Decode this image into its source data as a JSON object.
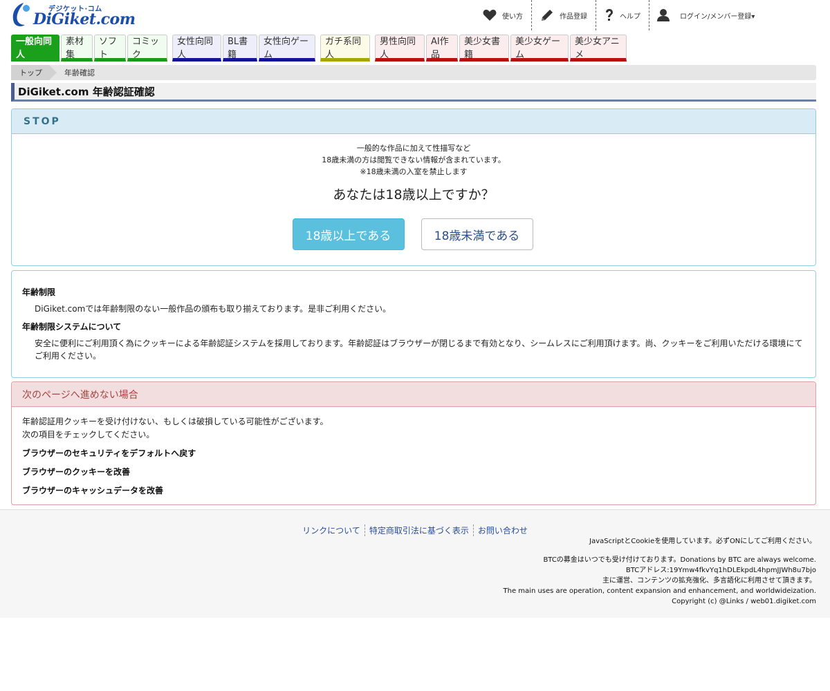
{
  "header": {
    "logo_sub": "デジケット·コム",
    "logo_main": "DiGiket.com",
    "nav": [
      {
        "icon": "heart-icon",
        "label": "使い方"
      },
      {
        "icon": "pencil-icon",
        "label": "作品登録"
      },
      {
        "icon": "question-icon",
        "label": "ヘルプ"
      },
      {
        "icon": "user-icon",
        "label": "ログイン/メンバー登録▾"
      }
    ]
  },
  "tabs": [
    {
      "label": "一般向同人",
      "group": "green",
      "active": true
    },
    {
      "label": "素材集",
      "group": "green"
    },
    {
      "label": "ソフト",
      "group": "green"
    },
    {
      "label": "コミック",
      "group": "green"
    },
    {
      "label": "女性向同人",
      "group": "blue"
    },
    {
      "label": "BL書籍",
      "group": "blue"
    },
    {
      "label": "女性向ゲーム",
      "group": "blue"
    },
    {
      "label": "ガチ系同人",
      "group": "yellow"
    },
    {
      "label": "男性向同人",
      "group": "red"
    },
    {
      "label": "AI作品",
      "group": "red"
    },
    {
      "label": "美少女書籍",
      "group": "red"
    },
    {
      "label": "美少女ゲーム",
      "group": "red"
    },
    {
      "label": "美少女アニメ",
      "group": "red"
    }
  ],
  "breadcrumb": {
    "top": "トップ",
    "current": "年齢確認"
  },
  "page_title": "DiGiket.com 年齢認証確認",
  "stop": {
    "heading": "STOP",
    "lines": [
      "一般的な作品に加えて性描写など",
      "18歳未満の方は閲覧できない情報が含まれています。",
      "※18歳未満の入室を禁止します"
    ],
    "question": "あなたは18歳以上ですか？",
    "yes_label": "18歳以上である",
    "no_label": "18歳未満である"
  },
  "info": {
    "h1": "年齢制限",
    "p1": "DiGiket.comでは年齢制限のない一般作品の頒布も取り揃えております。是非ご利用ください。",
    "h2": "年齢制限システムについて",
    "p2": "安全に便利にご利用頂く為にクッキーによる年齢認証システムを採用しております。年齢認証はブラウザーが閉じるまで有効となり、シームレスにご利用頂けます。尚、クッキーをご利用いただける環境にてご利用ください。"
  },
  "warn": {
    "heading": "次のページへ進めない場合",
    "line1": "年齢認証用クッキーを受け付けない、もしくは破損している可能性がございます。",
    "line2": "次の項目をチェックしてください。",
    "items": [
      "ブラウザーのセキュリティをデフォルトへ戻す",
      "ブラウザーのクッキーを改善",
      "ブラウザーのキャッシュデータを改善"
    ]
  },
  "footer": {
    "links": [
      "リンクについて",
      "特定商取引法に基づく表示",
      "お問い合わせ"
    ],
    "js_note": "JavaScriptとCookieを使用しています。必ずONにしてご利用ください。",
    "btc1": "BTCの募金はいつでも受け付けております。Donations by BTC are always welcome.",
    "btc2": "BTCアドレス:19Ymw4fkvYq1hDLEkpdL4hpmJJWh8u7bjo",
    "btc3": "主に運営、コンテンツの拡充強化、多言語化に利用させて頂きます。",
    "btc4": "The main uses are operation, content expansion and enhancement, and worldwideization.",
    "copyright": "Copyright (c) @Links / web01.digiket.com"
  },
  "colors": {
    "green": "#1aa01a",
    "blue": "#12129a",
    "yellow": "#a6a600",
    "red": "#b80f0f",
    "info": "#5bc0de"
  }
}
